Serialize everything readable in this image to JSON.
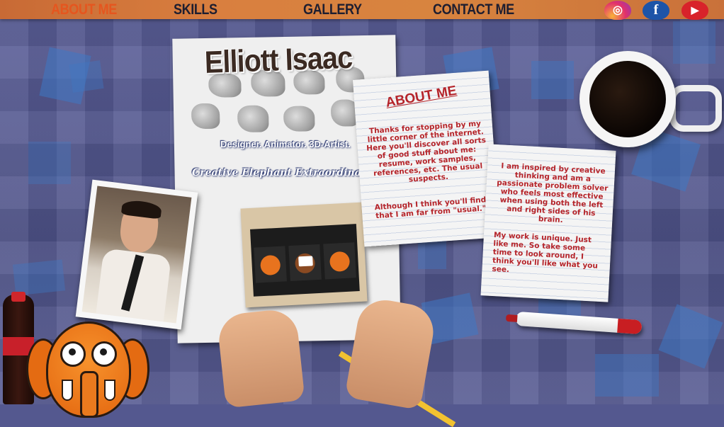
{
  "nav": {
    "items": [
      {
        "label": "ABOUT ME",
        "active": true
      },
      {
        "label": "SKILLS",
        "active": false
      },
      {
        "label": "GALLERY",
        "active": false
      },
      {
        "label": "CONTACT ME",
        "active": false
      }
    ],
    "social": [
      {
        "icon": "instagram-icon",
        "glyph": "◎",
        "color": "#8a3ab9"
      },
      {
        "icon": "facebook-icon",
        "glyph": "f",
        "color": "#1d54a8"
      },
      {
        "icon": "youtube-icon",
        "glyph": "▶",
        "color": "#d8232a"
      }
    ]
  },
  "header": {
    "name": "Elliott Isaac",
    "tagline": "Designer. Animator. 3D-Artist.",
    "subtitle": "Creative Elephant Extraordinaire."
  },
  "about_note": {
    "title": "ABOUT ME",
    "para1": "Thanks for stopping by my little corner of the internet. Here you'll discover all sorts of good stuff about me: resume, work samples, references, etc. The usual suspects.",
    "para2": "Although I think you'll find that I am far from \"usual.\""
  },
  "second_note": {
    "para1": "I am inspired by creative thinking and am a passionate problem solver who feels most effective when using both the left and right sides of his brain.",
    "para2": "My work is unique. Just like me. So take some time to look around, I think you'll like what you see."
  },
  "colors": {
    "accent": "#e5561f",
    "note_text": "#b5242a",
    "nav_bar": "#d97f3f"
  }
}
